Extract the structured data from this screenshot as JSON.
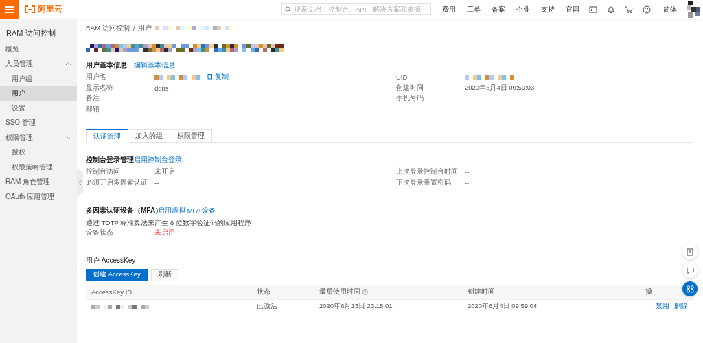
{
  "topbar": {
    "logo_text": "阿里云",
    "search": {
      "placeholder": "搜索文档、控制台、API、解决方案和资源"
    },
    "links": [
      "费用",
      "工单",
      "备案",
      "企业",
      "支持",
      "官网"
    ],
    "language": "简体"
  },
  "sidebar": {
    "title": "RAM 访问控制",
    "items": [
      {
        "label": "概览",
        "selected": false
      },
      {
        "label": "人员管理",
        "selected": false,
        "expanded": true,
        "children": [
          {
            "label": "用户组",
            "selected": false
          },
          {
            "label": "用户",
            "selected": true
          },
          {
            "label": "设置",
            "selected": false
          }
        ]
      },
      {
        "label": "SSO 管理",
        "selected": false
      },
      {
        "label": "权限管理",
        "selected": false,
        "expanded": true,
        "children": [
          {
            "label": "授权",
            "selected": false
          },
          {
            "label": "权限策略管理",
            "selected": false
          }
        ]
      },
      {
        "label": "RAM 角色管理",
        "selected": false
      },
      {
        "label": "OAuth 应用管理",
        "selected": false
      }
    ]
  },
  "breadcrumb": {
    "separator": "/",
    "items": [
      {
        "label": "RAM 访问控制"
      },
      {
        "label": "用户",
        "tail": {
          "kind": "redacted"
        }
      }
    ]
  },
  "title": {
    "kind": "redacted"
  },
  "basic_info": {
    "heading": "用户基本信息",
    "edit_link": "编辑基本信息",
    "left_fields": [
      {
        "label": "用户名",
        "value": {
          "kind": "redacted"
        },
        "copy": "复制"
      },
      {
        "label": "显示名称",
        "value": {
          "kind": "text",
          "text": "ddns"
        }
      },
      {
        "label": "备注"
      },
      {
        "label": "邮箱"
      }
    ],
    "right_fields": [
      {
        "label": "UID",
        "value": {
          "kind": "redacted"
        }
      },
      {
        "label": "创建时间",
        "value": {
          "kind": "text",
          "text": "2020年6月4日 09:59:03"
        }
      },
      {
        "label": "手机号码"
      }
    ]
  },
  "tabs": [
    {
      "label": "认证管理",
      "selected": true
    },
    {
      "label": "加入的组",
      "selected": false
    },
    {
      "label": "权限管理",
      "selected": false
    }
  ],
  "console_login": {
    "heading": "控制台登录管理",
    "action": "启用控制台登录",
    "left_fields": [
      {
        "label": "控制台访问",
        "value": {
          "kind": "text",
          "text": "未开启"
        }
      },
      {
        "label": "必须开启多因素认证",
        "value": {
          "kind": "text",
          "text": "--"
        }
      }
    ],
    "right_fields": [
      {
        "label": "上次登录控制台时间",
        "value": {
          "kind": "text",
          "text": "--"
        }
      },
      {
        "label": "下次登录重置密码",
        "value": {
          "kind": "text",
          "text": "--"
        }
      }
    ]
  },
  "mfa": {
    "heading": "多因素认证设备（MFA）",
    "action": "启用虚拟 MFA 设备",
    "description": "通过 TOTP 标准算法来产生 6 位数字验证码的应用程序",
    "status_label": "设备状态",
    "status": "未启用",
    "enabled": false
  },
  "access_keys": {
    "heading": "用户 AccessKey",
    "buttons": [
      {
        "label": "创建 AccessKey",
        "kind": "primary"
      },
      {
        "label": "刷新",
        "kind": "normal"
      }
    ],
    "columns": [
      {
        "label": "AccessKey ID",
        "kind": "plain"
      },
      {
        "label": "状态",
        "kind": "plain"
      },
      {
        "label": "最后使用时间",
        "kind": "help"
      },
      {
        "label": "创建时间",
        "kind": "plain"
      },
      {
        "label": "操",
        "kind": "plain"
      }
    ],
    "rows": [
      {
        "id": {
          "kind": "redacted"
        },
        "status": "已激活",
        "last_used": "2020年6月13日 23:15:01",
        "created": "2020年6月4日 09:59:04",
        "actions": [
          "禁用",
          "删除"
        ]
      }
    ]
  }
}
